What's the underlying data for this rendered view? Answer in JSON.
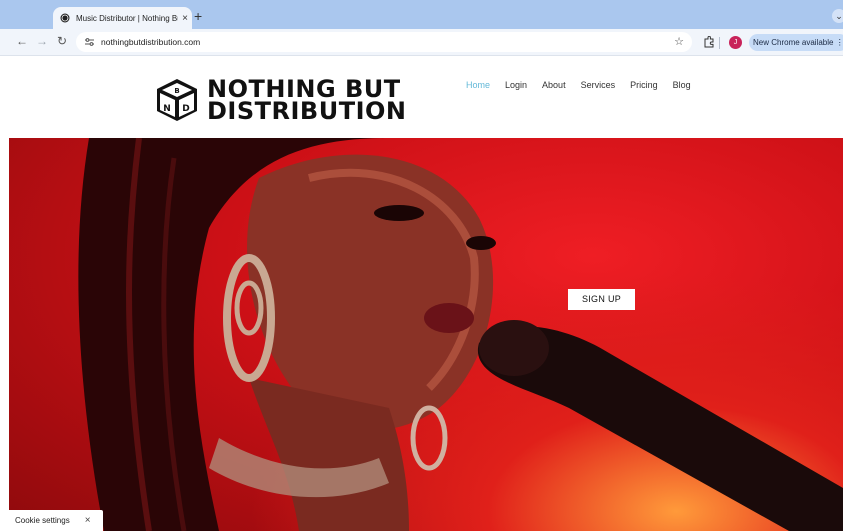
{
  "browser": {
    "tab_title": "Music Distributor | Nothing But",
    "tab_close": "×",
    "new_tab": "+",
    "url": "nothingbutdistribution.com",
    "profile_initial": "J",
    "update_label": "New Chrome available",
    "menu_glyph": "⋮",
    "tab_search_glyph": "⌄"
  },
  "site": {
    "logo_line1": "NOTHING BUT",
    "logo_line2": "DISTRIBUTION",
    "nav": [
      "Home",
      "Login",
      "About",
      "Services",
      "Pricing",
      "Blog"
    ],
    "active_nav": "Home",
    "cta": "SIGN UP"
  },
  "cookie": {
    "label": "Cookie settings",
    "close": "×"
  },
  "colors": {
    "nav_active": "#63b8d8",
    "hero_red": "#d3141a",
    "tabbar": "#aac7ee",
    "profile": "#c8235a"
  },
  "icons": [
    "globe-icon",
    "back-icon",
    "forward-icon",
    "reload-icon",
    "site-settings-icon",
    "star-icon",
    "extensions-icon",
    "cube-logo-icon"
  ]
}
